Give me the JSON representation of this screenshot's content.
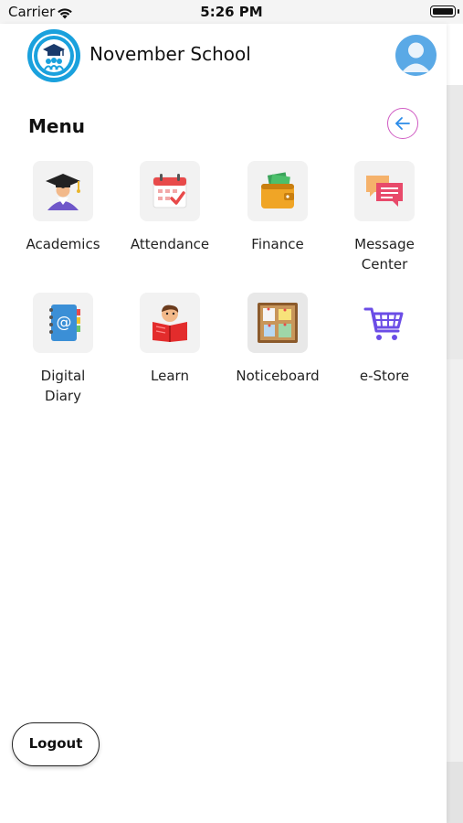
{
  "status_bar": {
    "carrier": "Carrier",
    "time": "5:26 PM"
  },
  "header": {
    "school_name": "November School"
  },
  "menu": {
    "title": "Menu",
    "items": [
      {
        "label": "Academics",
        "icon": "graduation-icon"
      },
      {
        "label": "Attendance",
        "icon": "calendar-check-icon"
      },
      {
        "label": "Finance",
        "icon": "wallet-icon"
      },
      {
        "label": "Message Center",
        "icon": "message-icon"
      },
      {
        "label": "Digital Diary",
        "icon": "diary-icon"
      },
      {
        "label": "Learn",
        "icon": "reading-student-icon"
      },
      {
        "label": "Noticeboard",
        "icon": "noticeboard-icon"
      },
      {
        "label": "e-Store",
        "icon": "cart-icon"
      }
    ]
  },
  "footer": {
    "logout_label": "Logout"
  },
  "colors": {
    "accent_blue": "#1aa1dd",
    "avatar_blue": "#5aa9e6",
    "back_ring": "#d05cc3",
    "cart_purple": "#6b4de6"
  }
}
